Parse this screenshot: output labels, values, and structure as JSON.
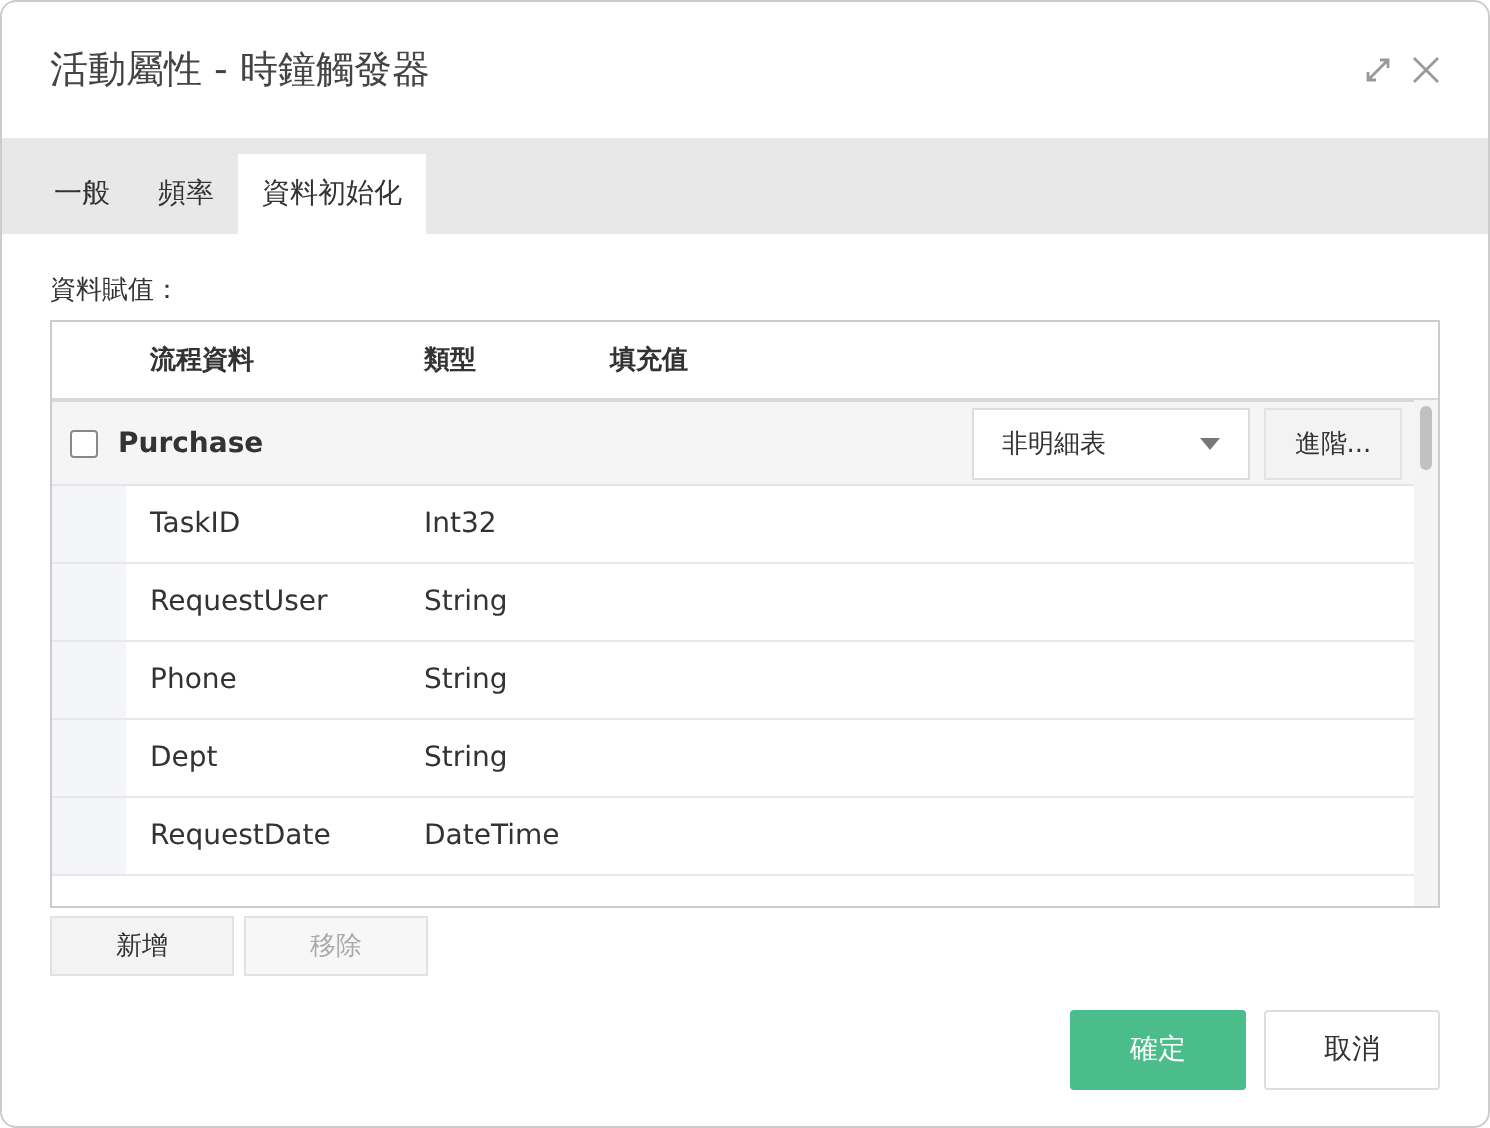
{
  "window": {
    "title": "活動屬性 - 時鐘觸發器"
  },
  "tabs": [
    {
      "label": "一般",
      "selected": false
    },
    {
      "label": "頻率",
      "selected": false
    },
    {
      "label": "資料初始化",
      "selected": true
    }
  ],
  "section_label": "資料賦值：",
  "table": {
    "columns": [
      "流程資料",
      "類型",
      "填充值"
    ],
    "group": {
      "name": "Purchase",
      "checked": false,
      "select_value": "非明細表",
      "advanced_button": "進階..."
    },
    "rows": [
      {
        "name": "TaskID",
        "type": "Int32"
      },
      {
        "name": "RequestUser",
        "type": "String"
      },
      {
        "name": "Phone",
        "type": "String"
      },
      {
        "name": "Dept",
        "type": "String"
      },
      {
        "name": "RequestDate",
        "type": "DateTime"
      }
    ]
  },
  "table_buttons": [
    {
      "label": "新增",
      "disabled": false
    },
    {
      "label": "移除",
      "disabled": true
    }
  ],
  "footer_buttons": [
    {
      "label": "確定",
      "kind": "primary"
    },
    {
      "label": "取消",
      "kind": "secondary"
    }
  ]
}
